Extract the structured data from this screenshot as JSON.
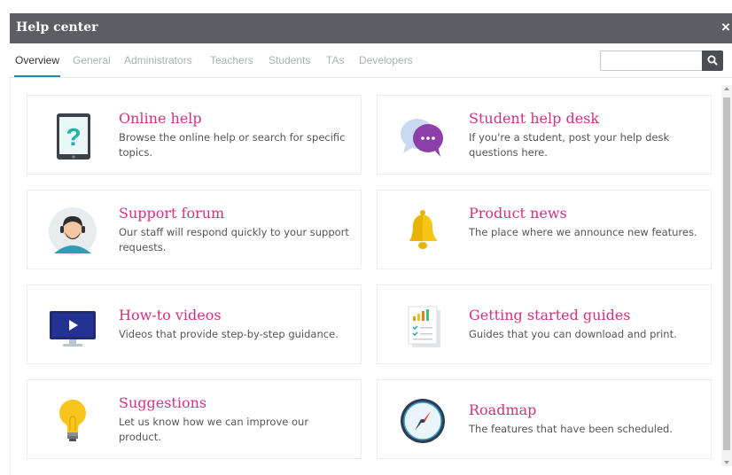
{
  "window": {
    "title": "Help center",
    "close_glyph": "×"
  },
  "tabs": [
    {
      "label": "Overview",
      "active": true
    },
    {
      "label": "General"
    },
    {
      "label": "Administrators"
    },
    {
      "label": "Teachers"
    },
    {
      "label": "Students"
    },
    {
      "label": "TAs"
    },
    {
      "label": "Developers"
    }
  ],
  "search": {
    "value": "",
    "placeholder": "",
    "icon": "search-icon"
  },
  "cards": [
    {
      "title": "Online help",
      "desc": "Browse the online help or search for specific topics.",
      "icon": "tablet-question-icon"
    },
    {
      "title": "Student help desk",
      "desc": "If you're a student, post your help desk questions here.",
      "icon": "chat-bubbles-icon"
    },
    {
      "title": "Support forum",
      "desc": "Our staff will respond quickly to your support requests.",
      "icon": "support-agent-icon"
    },
    {
      "title": "Product news",
      "desc": "The place where we announce new features.",
      "icon": "bell-icon"
    },
    {
      "title": "How-to videos",
      "desc": "Videos that provide step-by-step guidance.",
      "icon": "video-monitor-icon"
    },
    {
      "title": "Getting started guides",
      "desc": "Guides that you can download and print.",
      "icon": "document-chart-icon"
    },
    {
      "title": "Suggestions",
      "desc": "Let us know how we can improve our product.",
      "icon": "lightbulb-icon"
    },
    {
      "title": "Roadmap",
      "desc": "The features that have been scheduled.",
      "icon": "compass-icon"
    }
  ],
  "colors": {
    "titlebar": "#5b5e63",
    "accent_tab": "#1f8fae",
    "card_title": "#d0337f",
    "search_button": "#4a4d52"
  }
}
